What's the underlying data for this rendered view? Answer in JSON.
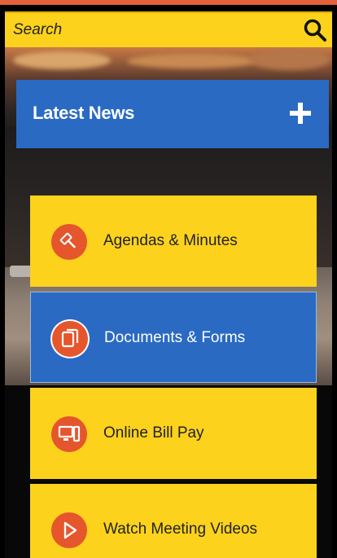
{
  "search": {
    "placeholder": "Search"
  },
  "news": {
    "title": "Latest News"
  },
  "menu": [
    {
      "label": "Agendas & Minutes",
      "icon": "gavel-icon"
    },
    {
      "label": "Documents & Forms",
      "icon": "documents-icon"
    },
    {
      "label": "Online Bill Pay",
      "icon": "computer-icon"
    },
    {
      "label": "Watch Meeting Videos",
      "icon": "play-icon"
    }
  ],
  "colors": {
    "accent_yellow": "#fcd21d",
    "accent_blue": "#2a6ac3",
    "icon_orange": "#e5562c",
    "top_accent": "#e2613a"
  }
}
